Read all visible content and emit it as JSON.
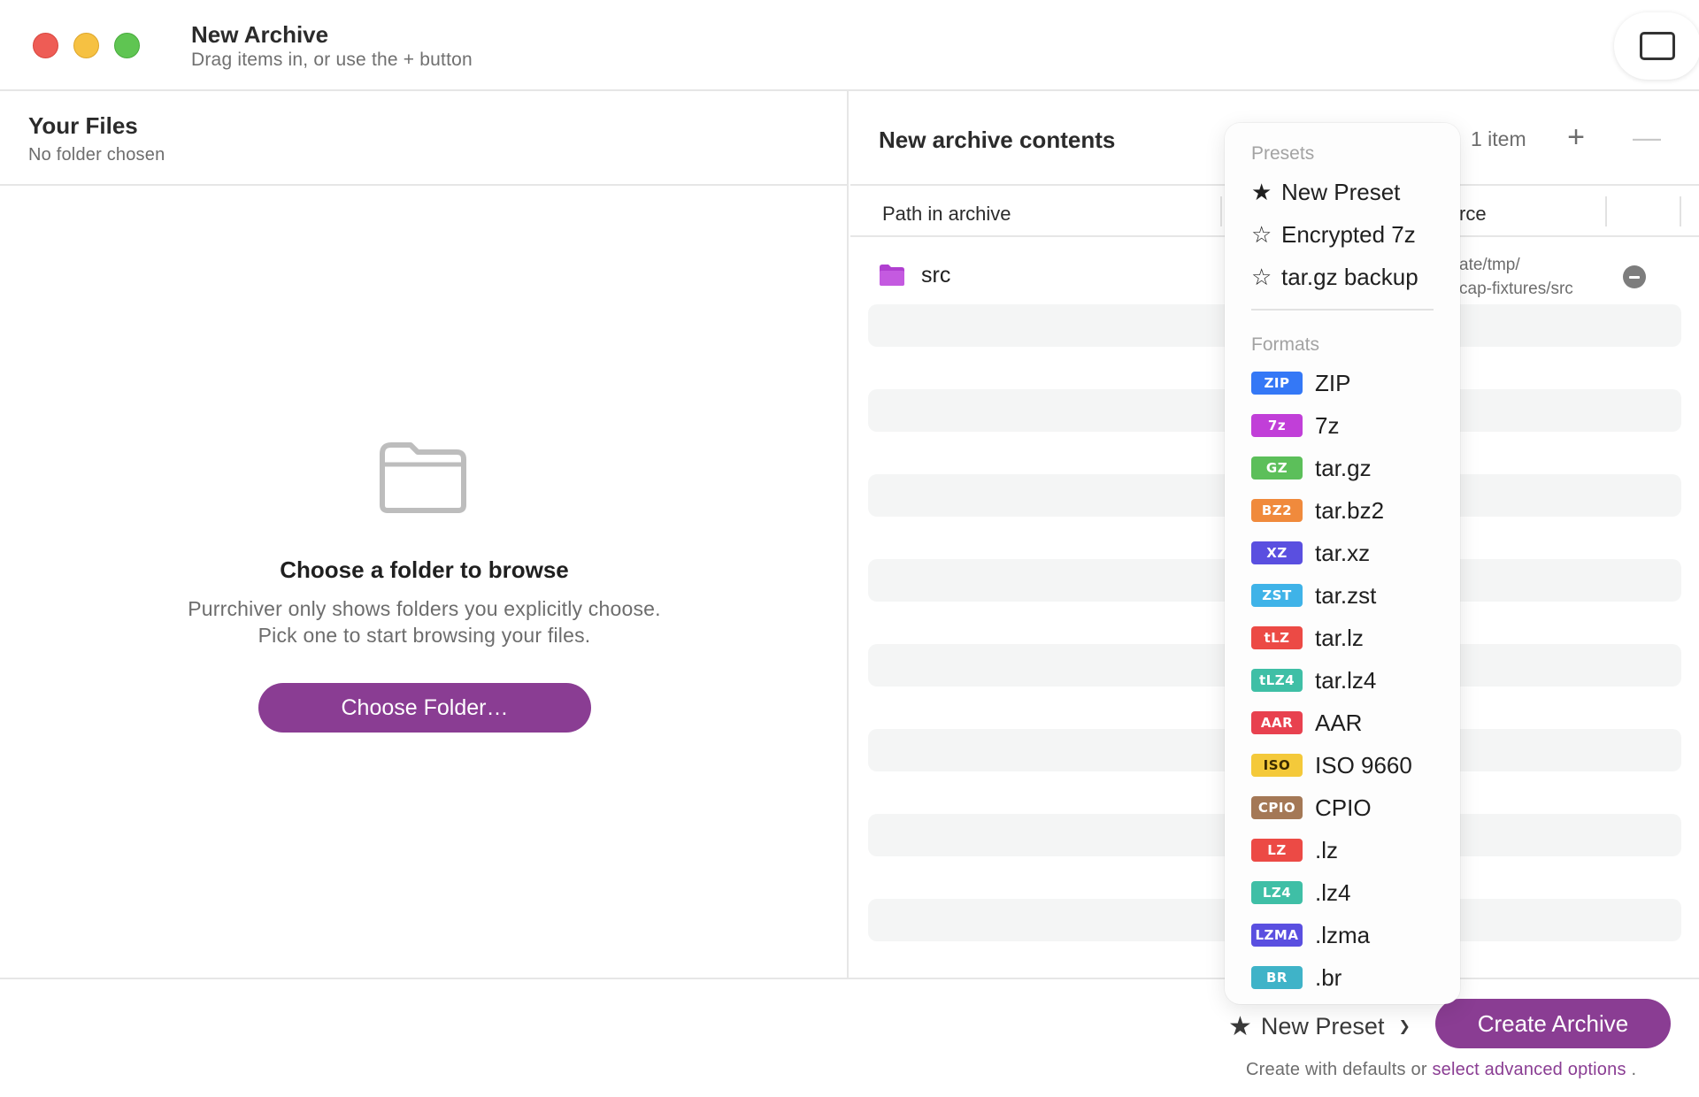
{
  "window": {
    "title": "New Archive",
    "subtitle": "Drag items in, or use the + button"
  },
  "left_pane": {
    "title": "Your Files",
    "subtitle": "No folder chosen",
    "empty_title": "Choose a folder to browse",
    "empty_body": "Purrchiver only shows folders you explicitly choose. Pick one to start browsing your files.",
    "choose_button": "Choose Folder…"
  },
  "right_pane": {
    "title": "New archive contents",
    "item_count": "1 item",
    "add_label": "+",
    "remove_label": "—",
    "columns": {
      "path": "Path in archive",
      "source": "rce"
    },
    "rows": [
      {
        "name": "src",
        "source_line1": "ate/tmp/",
        "source_line2": "cap-fixtures/src"
      }
    ]
  },
  "footer": {
    "preset_label": "New Preset",
    "create_button": "Create Archive",
    "hint_prefix": "Create with defaults or",
    "hint_link": "select advanced options",
    "hint_suffix": "."
  },
  "menu": {
    "presets_header": "Presets",
    "presets": [
      {
        "label": "New Preset",
        "star": "★",
        "icon": "star-filled-icon"
      },
      {
        "label": "Encrypted 7z",
        "star": "☆",
        "icon": "star-outline-icon"
      },
      {
        "label": "tar.gz backup",
        "star": "☆",
        "icon": "star-outline-icon"
      }
    ],
    "formats_header": "Formats",
    "formats": [
      {
        "badge": "ZIP",
        "label": "ZIP",
        "color": "#3478f6",
        "text_color": "#ffffff"
      },
      {
        "badge": "7z",
        "label": "7z",
        "color": "#c13fd8",
        "text_color": "#ffffff"
      },
      {
        "badge": "GZ",
        "label": "tar.gz",
        "color": "#5cbf5a",
        "text_color": "#ffffff"
      },
      {
        "badge": "BZ2",
        "label": "tar.bz2",
        "color": "#f08a3c",
        "text_color": "#ffffff"
      },
      {
        "badge": "XZ",
        "label": "tar.xz",
        "color": "#5a4fe0",
        "text_color": "#ffffff"
      },
      {
        "badge": "ZST",
        "label": "tar.zst",
        "color": "#3fb3e8",
        "text_color": "#ffffff"
      },
      {
        "badge": "tLZ",
        "label": "tar.lz",
        "color": "#ec4a45",
        "text_color": "#ffffff"
      },
      {
        "badge": "tLZ4",
        "label": "tar.lz4",
        "color": "#3fbfa6",
        "text_color": "#ffffff"
      },
      {
        "badge": "AAR",
        "label": "AAR",
        "color": "#e8414f",
        "text_color": "#ffffff"
      },
      {
        "badge": "ISO",
        "label": "ISO 9660",
        "color": "#f4c93a",
        "text_color": "#3a2a00"
      },
      {
        "badge": "CPIO",
        "label": "CPIO",
        "color": "#a47856",
        "text_color": "#ffffff"
      },
      {
        "badge": "LZ",
        "label": ".lz",
        "color": "#ec4a45",
        "text_color": "#ffffff"
      },
      {
        "badge": "LZ4",
        "label": ".lz4",
        "color": "#3fbfa6",
        "text_color": "#ffffff"
      },
      {
        "badge": "LZMA",
        "label": ".lzma",
        "color": "#5a4fe0",
        "text_color": "#ffffff"
      },
      {
        "badge": "BR",
        "label": ".br",
        "color": "#3fb3c8",
        "text_color": "#ffffff"
      }
    ]
  },
  "colors": {
    "accent": "#8a3d93",
    "folder": "#b03fd0"
  }
}
